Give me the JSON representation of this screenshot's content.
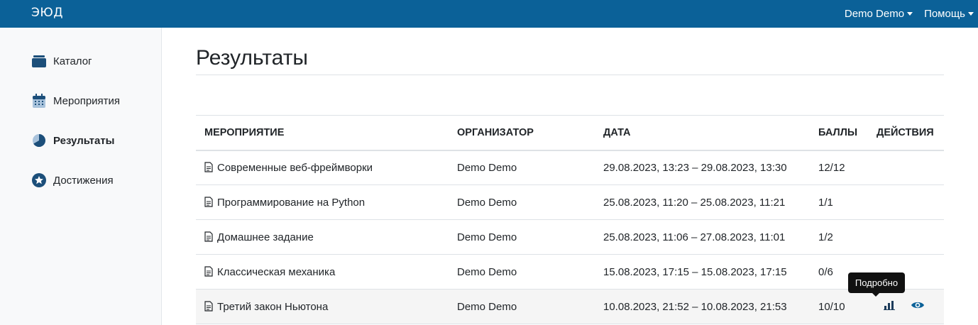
{
  "header": {
    "logo": "ЭЮД",
    "user_menu": "Demo Demo",
    "help_menu": "Помощь"
  },
  "sidebar": {
    "items": [
      {
        "label": "Каталог",
        "icon": "catalog-icon"
      },
      {
        "label": "Мероприятия",
        "icon": "calendar-icon"
      },
      {
        "label": "Результаты",
        "icon": "pie-chart-icon",
        "active": true
      },
      {
        "label": "Достижения",
        "icon": "star-icon"
      }
    ]
  },
  "main": {
    "title": "Результаты",
    "table": {
      "headers": [
        "МЕРОПРИЯТИЕ",
        "ОРГАНИЗАТОР",
        "ДАТА",
        "БАЛЛЫ",
        "ДЕЙСТВИЯ"
      ],
      "rows": [
        {
          "event": "Современные веб-фреймворки",
          "organizer": "Demo Demo",
          "date": "29.08.2023, 13:23 – 29.08.2023, 13:30",
          "score": "12/12"
        },
        {
          "event": "Программирование на Python",
          "organizer": "Demo Demo",
          "date": "25.08.2023, 11:20 – 25.08.2023, 11:21",
          "score": "1/1"
        },
        {
          "event": "Домашнее задание",
          "organizer": "Demo Demo",
          "date": "25.08.2023, 11:06 – 27.08.2023, 11:01",
          "score": "1/2"
        },
        {
          "event": "Классическая механика",
          "organizer": "Demo Demo",
          "date": "15.08.2023, 17:15 – 15.08.2023, 17:15",
          "score": "0/6"
        },
        {
          "event": "Третий закон Ньютона",
          "organizer": "Demo Demo",
          "date": "10.08.2023, 21:52 – 10.08.2023, 21:53",
          "score": "10/10"
        }
      ]
    },
    "tooltip": "Подробно"
  },
  "colors": {
    "brand": "#0b6198",
    "icon": "#1c4f7a",
    "action_icon": "#0b6198"
  }
}
